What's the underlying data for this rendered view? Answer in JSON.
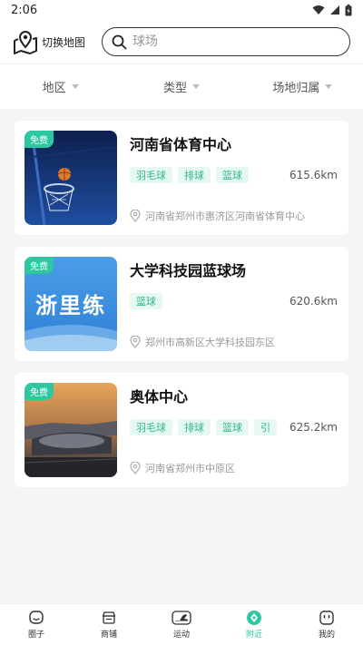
{
  "status_bar": {
    "time": "2:06"
  },
  "header": {
    "map_switch_label": "切换地图",
    "search_placeholder": "球场"
  },
  "filters": [
    {
      "label": "地区"
    },
    {
      "label": "类型"
    },
    {
      "label": "场地归属"
    }
  ],
  "venues": [
    {
      "badge": "免费",
      "name": "河南省体育中心",
      "tags": [
        "羽毛球",
        "排球",
        "篮球"
      ],
      "distance": "615.6km",
      "address": "河南省郑州市惠济区河南省体育中心"
    },
    {
      "badge": "免费",
      "name": "大学科技园蓝球场",
      "tags": [
        "篮球"
      ],
      "distance": "620.6km",
      "address": "郑州市高新区大学科技园东区",
      "thumb_text": "浙里练"
    },
    {
      "badge": "免费",
      "name": "奥体中心",
      "tags": [
        "羽毛球",
        "排球",
        "篮球",
        "引"
      ],
      "distance": "625.2km",
      "address": "河南省郑州市中原区"
    }
  ],
  "bottom_nav": [
    {
      "label": "圈子",
      "icon": "chat-icon"
    },
    {
      "label": "商铺",
      "icon": "shop-icon"
    },
    {
      "label": "运动",
      "icon": "shoe-icon"
    },
    {
      "label": "附近",
      "icon": "location-icon",
      "active": true
    },
    {
      "label": "我的",
      "icon": "profile-icon"
    }
  ],
  "colors": {
    "accent": "#2fc7a1",
    "tag_bg": "#e6f8f2"
  }
}
